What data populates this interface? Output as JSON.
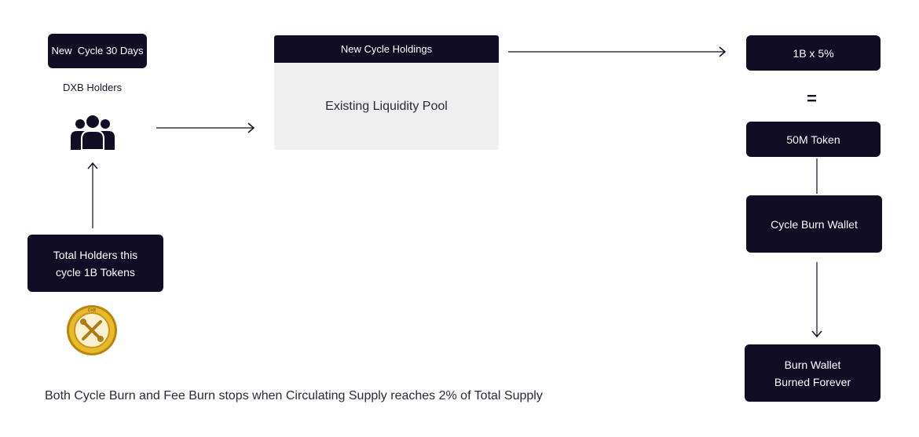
{
  "left": {
    "cycle_badge": "New  Cycle 30 Days",
    "holders_label": "DXB Holders",
    "total_holders_line1": "Total Holders this",
    "total_holders_line2": "cycle 1B Tokens",
    "coin_logo_text": "DXB"
  },
  "pool": {
    "header": "New Cycle Holdings",
    "body": "Existing Liquidity Pool"
  },
  "right": {
    "formula": "1B x 5%",
    "equals": "=",
    "result": "50M Token",
    "burn_wallet": "Cycle Burn Wallet",
    "final_line1": "Burn Wallet",
    "final_line2": "Burned Forever"
  },
  "footer": "Both Cycle Burn and Fee Burn stops when Circulating Supply reaches 2% of Total Supply",
  "colors": {
    "dark": "#100d24",
    "pool_bg": "#efefef",
    "coin_gold": "#d4a21a"
  },
  "icons": [
    "group-users-icon",
    "dxb-coin-logo"
  ]
}
